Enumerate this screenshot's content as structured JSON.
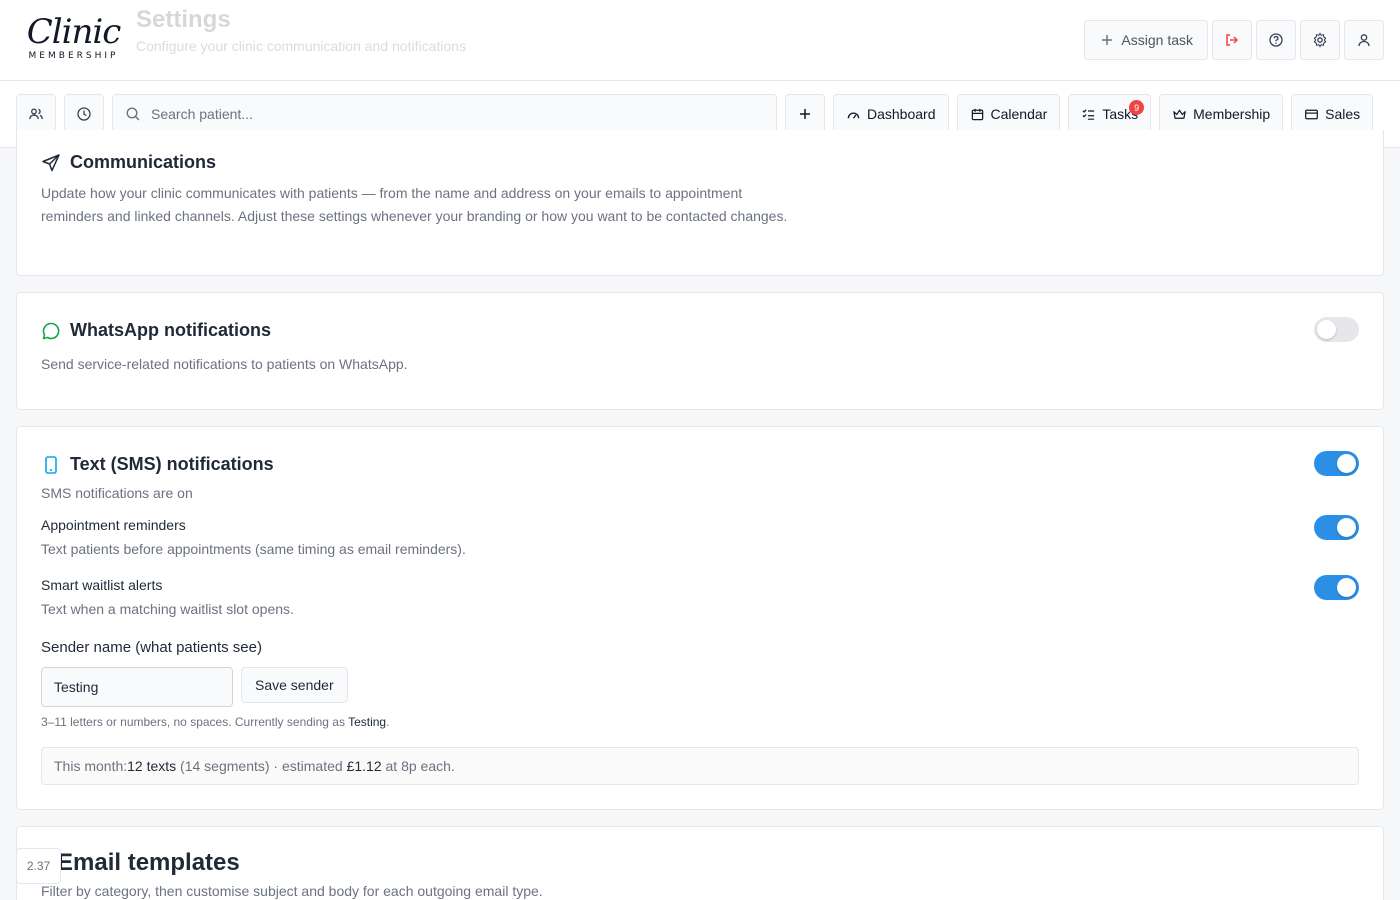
{
  "header": {
    "ghost_title": "Settings",
    "ghost_subtitle": "Configure your clinic communication and notifications",
    "logo_script": "Clinic",
    "logo_sub": "MEMBERSHIP",
    "assign_task_label": "Assign task"
  },
  "navbar": {
    "search_placeholder": "Search patient...",
    "items": [
      {
        "label": "Dashboard",
        "icon": "gauge-icon"
      },
      {
        "label": "Calendar",
        "icon": "calendar-icon"
      },
      {
        "label": "Tasks",
        "icon": "checklist-icon",
        "badge": "9"
      },
      {
        "label": "Membership",
        "icon": "crown-icon"
      },
      {
        "label": "Sales",
        "icon": "card-icon"
      }
    ]
  },
  "communications": {
    "title": "Communications",
    "description": "Update how your clinic communicates with patients — from the name and address on your emails to appointment reminders and linked channels. Adjust these settings whenever your branding or how you want to be contacted changes."
  },
  "whatsapp": {
    "title": "WhatsApp notifications",
    "description": "Send service-related notifications to patients on WhatsApp.",
    "enabled": false
  },
  "sms": {
    "title": "Text (SMS) notifications",
    "status": "SMS notifications are on",
    "enabled": true,
    "appointment_reminders": {
      "title": "Appointment reminders",
      "description": "Text patients before appointments (same timing as email reminders).",
      "enabled": true
    },
    "waitlist_alerts": {
      "title": "Smart waitlist alerts",
      "description": "Text when a matching waitlist slot opens.",
      "enabled": true
    },
    "sender_label": "Sender name (what patients see)",
    "sender_value": "Testing",
    "save_label": "Save sender",
    "hint_prefix": "3–11 letters or numbers, no spaces. Currently sending as ",
    "hint_name": "Testing",
    "hint_suffix": ".",
    "usage": {
      "prefix": "This month: ",
      "texts": "12 texts",
      "segments": " (14 segments) · estimated ",
      "cost": "£1.12",
      "suffix": " at 8p each."
    }
  },
  "email_templates": {
    "title": "Email templates",
    "description": "Filter by category, then customise subject and body for each outgoing email type."
  },
  "version": "2.37",
  "colors": {
    "accent": "#2b8fe5",
    "badge": "#ef4444",
    "whatsapp": "#16a34a",
    "sms_icon": "#0ea5e9",
    "logout": "#ef4444"
  }
}
